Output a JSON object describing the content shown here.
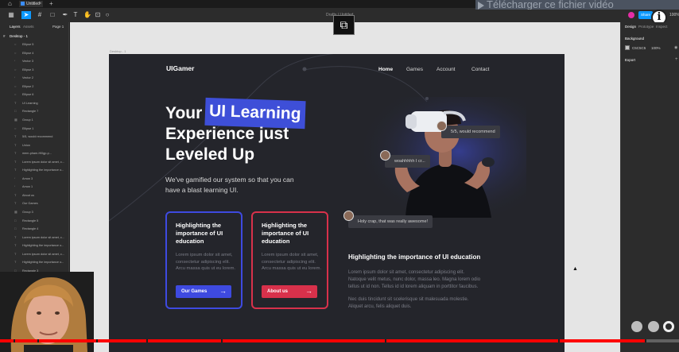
{
  "tabs": {
    "doc_tab": "Untitled"
  },
  "overlay": {
    "download_banner": "Télécharger ce fichier vidéo",
    "progress_fraction": 0.95,
    "chapter_gaps": [
      0.02,
      0.055,
      0.142,
      0.215,
      0.325,
      0.567,
      0.822,
      0.95
    ]
  },
  "toolbar": {
    "file_title": "Drafts / Untitled",
    "share_label": "Share",
    "zoom_label": "100%",
    "tools": [
      "grid-icon",
      "move-icon",
      "frame-icon",
      "shape-icon",
      "pen-icon",
      "text-icon",
      "hand-icon",
      "comment-icon"
    ]
  },
  "left_panel": {
    "tab_layers": "Layers",
    "tab_assets": "Assets",
    "page": "Page 1",
    "frame": "Desktop - 1",
    "layers": [
      "Ellipse 5",
      "Ellipse 4",
      "Vector 3",
      "Ellipse 3",
      "Vector 2",
      "Ellipse 2",
      "Ellipse 6",
      "UI Learning",
      "Rectangle 7",
      "Group 1",
      "Ellipse 1",
      "5/5, would recommend",
      "Union",
      "mem-pham-Hl0gp-p...",
      "Lorem ipsum dolor sit amet, c...",
      "Highlighting the importance o...",
      "Arrow 3",
      "Arrow 1",
      "About us",
      "Our Games",
      "Group 3",
      "Rectangle 5",
      "Rectangle 4",
      "Lorem ipsum dolor sit amet, c...",
      "Highlighting the importance o...",
      "Lorem ipsum dolor sit amet, c...",
      "Highlighting the importance o...",
      "Rectangle 3",
      "Rectangle 2"
    ]
  },
  "canvas": {
    "frame_name": "Desktop - 1"
  },
  "site": {
    "logo": "UIGamer",
    "nav": [
      "Home",
      "Games",
      "Account",
      "Contact"
    ],
    "hero_line1": "Your",
    "hero_highlight": "UI Learning",
    "hero_line2": "Experience just",
    "hero_line3": "Leveled Up",
    "hero_sub_1": "We've gamified our system so that you can",
    "hero_sub_2": "have a blast learning UI.",
    "cards": [
      {
        "title": "Highlighting the importance of UI education",
        "body": "Lorem ipsum dolor sit amet, consectetur adipiscing elit. Arcu massa quis ut eu lorem.",
        "button": "Our Games"
      },
      {
        "title": "Highlighting the importance of UI education",
        "body": "Lorem ipsum dolor sit amet, consectetur adipiscing elit. Arcu massa quis ut eu lorem.",
        "button": "About us"
      }
    ],
    "bubbles": [
      "5/5, would recommend",
      "woahhhhh I cr...",
      "Holy crap, that was really awesome!"
    ],
    "section_title": "Highlighting the importance of UI education",
    "section_p1_1": "Lorem ipsum dolor sit amet, consectetur adipiscing elit.",
    "section_p1_2": "Natoque velit metus, nunc dolor, massa leo. Magna lorem odio",
    "section_p1_3": "tellus ut id non. Tellus id id lorem aliquam in porttitor faucibus.",
    "section_p2_1": "Nec duis tincidunt sit scelerisque sit malesuada molestie.",
    "section_p2_2": "Aliquet arcu, felis aliquet duis."
  },
  "right_panel": {
    "tab_design": "Design",
    "tab_prototype": "Prototype",
    "tab_inspect": "Inspect",
    "background_label": "Background",
    "bg_hex": "C5C5C5",
    "bg_opacity": "100%",
    "export_label": "Export"
  },
  "colors": {
    "accent_blue": "#3e4ae0",
    "accent_red": "#d8314b",
    "figma_blue": "#0d99ff"
  }
}
